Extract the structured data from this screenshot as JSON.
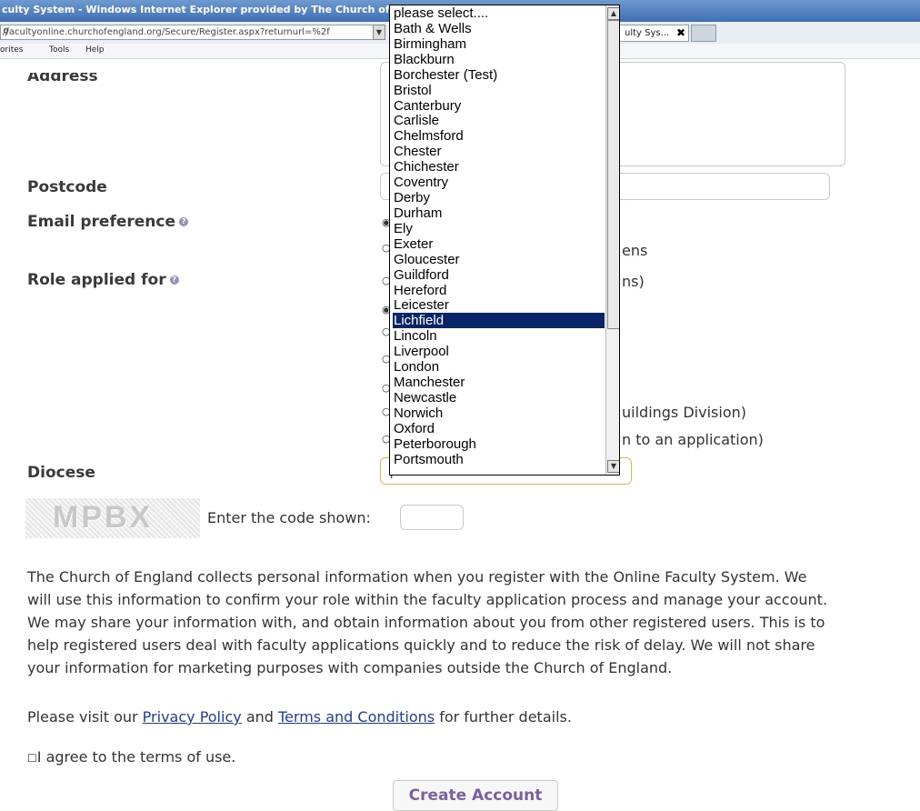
{
  "browser": {
    "title": "culty System - Windows Internet Explorer provided by The Church of E",
    "address_prefix": "/",
    "address_host": "/facultyonline.churchofengland.org/Secure/Register.aspx?returnurl=%2f",
    "search_icon": "magnifier-icon",
    "tab_title": "ulty Sys...",
    "tab_close": "✖",
    "menu": [
      "orites",
      "Tools",
      "Help"
    ]
  },
  "form": {
    "address_label": "Address",
    "postcode_label": "Postcode",
    "email_pref_label": "Email preference",
    "email_option_tail": "ens",
    "role_label": "Role applied for",
    "role_option_tail": "ns)",
    "role_option_buildings": "uildings Division)",
    "role_option_application": "n to an application)",
    "diocese_label": "Diocese",
    "diocese_selected": "please select...",
    "captcha_text": "MPBX",
    "code_label": "Enter the code shown:"
  },
  "dropdown": {
    "items": [
      "please select....",
      "Bath & Wells",
      "Birmingham",
      "Blackburn",
      "Borchester (Test)",
      "Bristol",
      "Canterbury",
      "Carlisle",
      "Chelmsford",
      "Chester",
      "Chichester",
      "Coventry",
      "Derby",
      "Durham",
      "Ely",
      "Exeter",
      "Gloucester",
      "Guildford",
      "Hereford",
      "Leicester",
      "Lichfield",
      "Lincoln",
      "Liverpool",
      "London",
      "Manchester",
      "Newcastle",
      "Norwich",
      "Oxford",
      "Peterborough",
      "Portsmouth"
    ],
    "highlighted": "Lichfield"
  },
  "privacy": {
    "line1": "The Church of England collects personal information when you register with the Online Faculty System. We",
    "line2": "will use this information to confirm your role within the faculty application process and manage your account.",
    "line3": "We may share your information with, and obtain information about you from other registered users. This is to",
    "line4": "help registered users deal with faculty applications quickly and to reduce the risk of delay. We will not share",
    "line5": "your information for marketing purposes with companies outside the Church of England.",
    "visit_prefix": "Please visit our",
    "privacy_link": "Privacy Policy",
    "and_text": "and",
    "terms_link": "Terms and Conditions",
    "visit_suffix": "for further details."
  },
  "agree_label": "I agree to the terms of use.",
  "create_button": "Create Account"
}
